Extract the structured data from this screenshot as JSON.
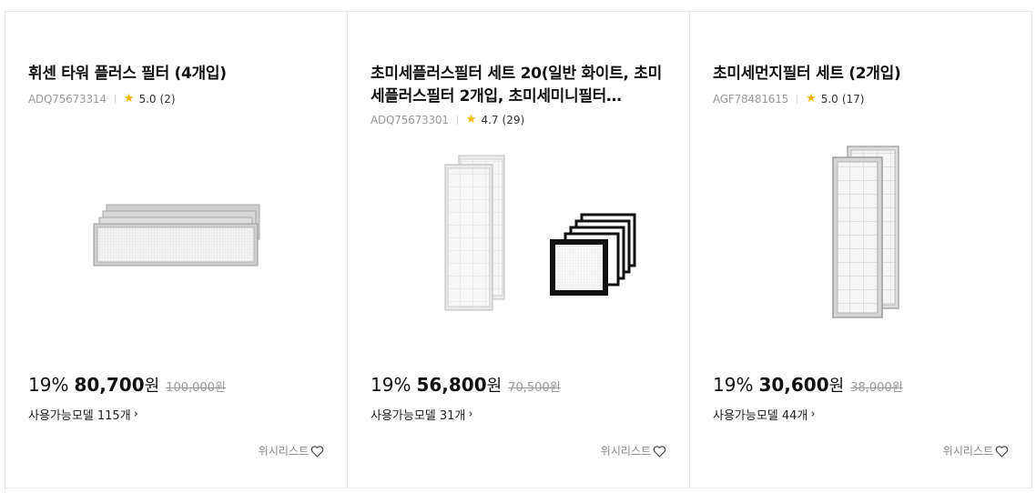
{
  "products": [
    {
      "title": "휘센 타워 플러스 필터 (4개입)",
      "sku": "ADQ75673314",
      "rating": "5.0",
      "review_count": "(2)",
      "discount": "19%",
      "price": "80,700",
      "currency": "원",
      "original_price": "100,000원",
      "models_label": "사용가능모델 115개",
      "wishlist_label": "위시리스트"
    },
    {
      "title": "초미세플러스필터 세트 20(일반 화이트, 초미세플러스필터 2개입, 초미세미니필터…",
      "sku": "ADQ75673301",
      "rating": "4.7",
      "review_count": "(29)",
      "discount": "19%",
      "price": "56,800",
      "currency": "원",
      "original_price": "70,500원",
      "models_label": "사용가능모델 31개",
      "wishlist_label": "위시리스트"
    },
    {
      "title": "초미세먼지필터 세트 (2개입)",
      "sku": "AGF78481615",
      "rating": "5.0",
      "review_count": "(17)",
      "discount": "19%",
      "price": "30,600",
      "currency": "원",
      "original_price": "38,000원",
      "models_label": "사용가능모델 44개",
      "wishlist_label": "위시리스트"
    }
  ],
  "icons": {
    "star": "star-icon",
    "heart": "heart-outline-icon",
    "chevron": "chevron-right-icon"
  },
  "colors": {
    "star": "#f5b400",
    "border": "#e9e9e9",
    "muted_text": "#999999"
  }
}
